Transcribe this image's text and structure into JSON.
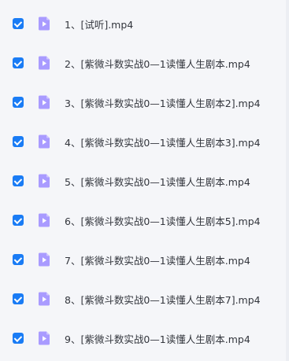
{
  "files": [
    {
      "name": "1、[试听].mp4",
      "checked": true,
      "icon": "video-file-icon"
    },
    {
      "name": "2、[紫微斗数实战0—1读懂人生剧本.mp4",
      "checked": true,
      "icon": "video-file-icon"
    },
    {
      "name": "3、[紫微斗数实战0—1读懂人生剧本2].mp4",
      "checked": true,
      "icon": "video-file-icon"
    },
    {
      "name": "4、[紫微斗数实战0—1读懂人生剧本3].mp4",
      "checked": true,
      "icon": "video-file-icon"
    },
    {
      "name": "5、[紫微斗数实战0—1读懂人生剧本.mp4",
      "checked": true,
      "icon": "video-file-icon"
    },
    {
      "name": "6、[紫微斗数实战0—1读懂人生剧本5].mp4",
      "checked": true,
      "icon": "video-file-icon"
    },
    {
      "name": "7、[紫微斗数实战0—1读懂人生剧本.mp4",
      "checked": true,
      "icon": "video-file-icon"
    },
    {
      "name": "8、[紫微斗数实战0—1读懂人生剧本7].mp4",
      "checked": true,
      "icon": "video-file-icon"
    },
    {
      "name": "9、[紫微斗数实战0—1读懂人生剧本.mp4",
      "checked": true,
      "icon": "video-file-icon"
    }
  ],
  "colors": {
    "background": "#f5f6f9",
    "checkbox": "#1a7cf5",
    "icon_body": "#a99bff",
    "icon_fold": "#cfc6ff",
    "text": "#33363d"
  }
}
